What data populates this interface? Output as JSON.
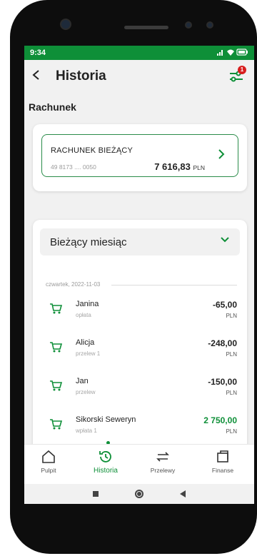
{
  "status": {
    "time": "9:34",
    "icons": "signal-wifi-battery"
  },
  "header": {
    "title": "Historia",
    "back_icon": "chevron-left-icon",
    "filter_icon": "filter-icon",
    "badge": "1"
  },
  "section": {
    "label": "Rachunek"
  },
  "account": {
    "name": "RACHUNEK BIEŻĄCY",
    "number": "49 8173 .... 0050",
    "balance": "7 616,83",
    "currency": "PLN"
  },
  "history": {
    "month": "Bieżący miesiąc",
    "date": "czwartek, 2022-11-03",
    "transactions": [
      {
        "name": "Janina",
        "sub": "opłata",
        "amount": "-65,00",
        "currency": "PLN"
      },
      {
        "name": "Alicja",
        "sub": "przelew 1",
        "amount": "-248,00",
        "currency": "PLN"
      },
      {
        "name": "Jan",
        "sub": "przelew",
        "amount": "-150,00",
        "currency": "PLN"
      },
      {
        "name": "Sikorski Seweryn",
        "sub": "wpłata 1",
        "amount": "2 750,00",
        "currency": "PLN"
      }
    ]
  },
  "nav": {
    "items": [
      {
        "label": "Pulpit",
        "icon": "home-icon"
      },
      {
        "label": "Historia",
        "icon": "history-icon"
      },
      {
        "label": "Przelewy",
        "icon": "transfer-icon"
      },
      {
        "label": "Finanse",
        "icon": "finance-icon"
      }
    ]
  },
  "colors": {
    "accent": "#0e8f38",
    "badge": "#d81e1e"
  }
}
